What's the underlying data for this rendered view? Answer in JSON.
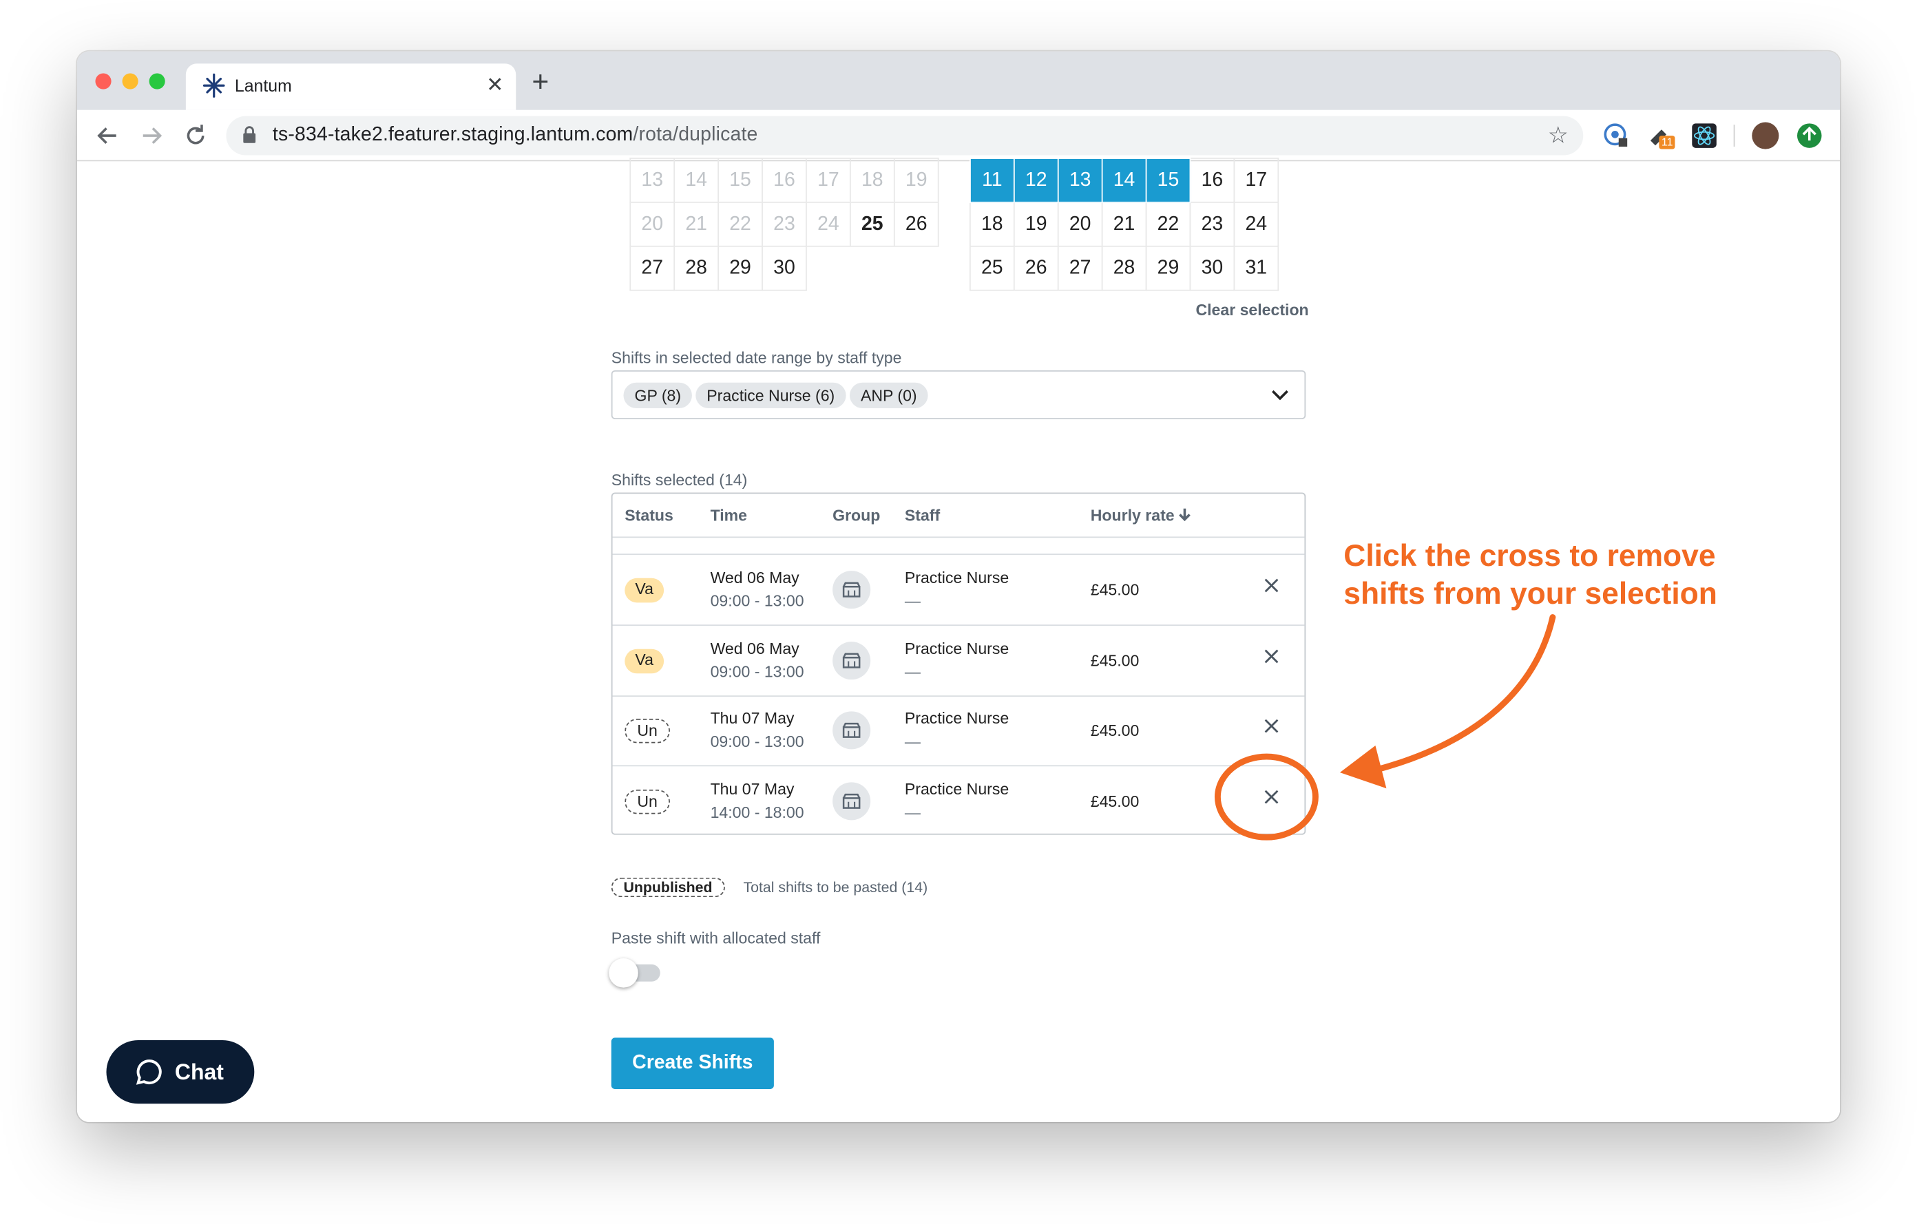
{
  "browser": {
    "tab_title": "Lantum",
    "url_host": "ts-834-take2.featurer.staging.lantum.com",
    "url_path": "/rota/duplicate",
    "extension_badge": "11"
  },
  "calendar": {
    "left_rows": [
      [
        "13",
        "14",
        "15",
        "16",
        "17",
        "18",
        "19"
      ],
      [
        "20",
        "21",
        "22",
        "23",
        "24",
        "25",
        "26"
      ],
      [
        "27",
        "28",
        "29",
        "30",
        "",
        "",
        ""
      ]
    ],
    "right_rows": [
      [
        "11",
        "12",
        "13",
        "14",
        "15",
        "16",
        "17"
      ],
      [
        "18",
        "19",
        "20",
        "21",
        "22",
        "23",
        "24"
      ],
      [
        "25",
        "26",
        "27",
        "28",
        "29",
        "30",
        "31"
      ]
    ],
    "clear_selection": "Clear selection"
  },
  "staff_type_filter": {
    "label": "Shifts in selected date range by staff type",
    "chips": [
      "GP (8)",
      "Practice Nurse (6)",
      "ANP (0)"
    ]
  },
  "shifts_table": {
    "label": "Shifts selected (14)",
    "headers": {
      "status": "Status",
      "time": "Time",
      "group": "Group",
      "staff": "Staff",
      "rate": "Hourly rate"
    },
    "rows": [
      {
        "status": "Va",
        "date": "Wed 06 May",
        "time": "09:00 - 13:00",
        "staff": "Practice Nurse",
        "staff_sub": "—",
        "rate": "£45.00"
      },
      {
        "status": "Va",
        "date": "Wed 06 May",
        "time": "09:00 - 13:00",
        "staff": "Practice Nurse",
        "staff_sub": "—",
        "rate": "£45.00"
      },
      {
        "status": "Un",
        "date": "Thu 07 May",
        "time": "09:00 - 13:00",
        "staff": "Practice Nurse",
        "staff_sub": "—",
        "rate": "£45.00"
      },
      {
        "status": "Un",
        "date": "Thu 07 May",
        "time": "14:00 - 18:00",
        "staff": "Practice Nurse",
        "staff_sub": "—",
        "rate": "£45.00"
      }
    ]
  },
  "summary": {
    "legend_badge": "Unpublished",
    "total_text": "Total shifts to be pasted (14)"
  },
  "paste_toggle": {
    "label": "Paste shift with allocated staff",
    "on": false
  },
  "create_button": "Create Shifts",
  "chat_button": "Chat",
  "annotation": {
    "line1": "Click the cross to remove",
    "line2": "shifts from your selection",
    "color": "#f26a22"
  },
  "colors": {
    "accent": "#1a9bd0",
    "vacant_badge": "#ffe3a6",
    "chat_bg": "#0b1c33"
  }
}
